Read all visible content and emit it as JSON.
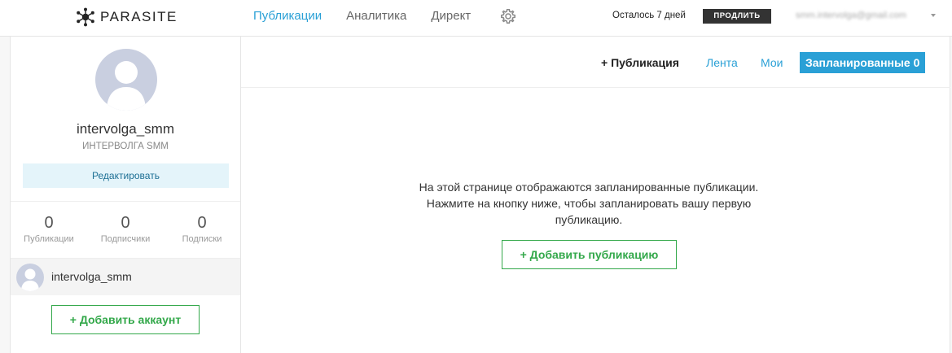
{
  "header": {
    "logo_text": "PARASITE",
    "nav": [
      {
        "label": "Публикации",
        "active": true
      },
      {
        "label": "Аналитика",
        "active": false
      },
      {
        "label": "Директ",
        "active": false
      }
    ],
    "settings_icon": "gear-icon",
    "remaining_text": "Осталось 7 дней",
    "extend_label": "ПРОДЛИТЬ",
    "user_email": "smm.intervolga@gmail.com"
  },
  "sidebar": {
    "username": "intervolga_smm",
    "full_name": "ИНТЕРВОЛГА SMM",
    "edit_label": "Редактировать",
    "stats": [
      {
        "value": "0",
        "label": "Публикации"
      },
      {
        "value": "0",
        "label": "Подписчики"
      },
      {
        "value": "0",
        "label": "Подписки"
      }
    ],
    "account": {
      "name": "intervolga_smm"
    },
    "add_account_label": "+ Добавить аккаунт"
  },
  "main": {
    "tabs": {
      "new_post": "+ Публикация",
      "feed": "Лента",
      "mine": "Мои",
      "scheduled": "Запланированные 0"
    },
    "empty_message": "На этой странице отображаются запланированные публикации. Нажмите на кнопку ниже, чтобы запланировать вашу первую публикацию.",
    "add_post_label": "+ Добавить публикацию"
  },
  "colors": {
    "accent": "#2aa0d6",
    "green": "#33a84a",
    "dark_button": "#333333",
    "edit_button_bg": "#e4f4fa",
    "avatar_placeholder": "#c9cfe0"
  }
}
